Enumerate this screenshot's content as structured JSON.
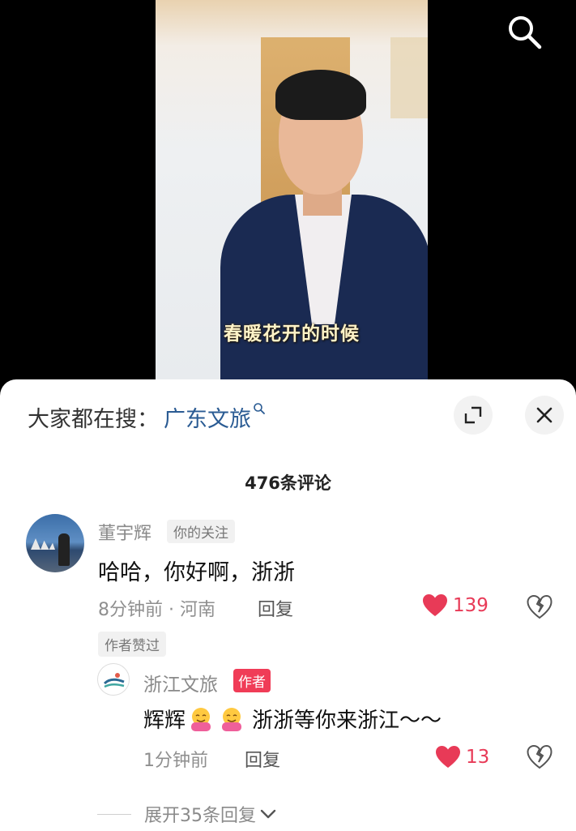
{
  "video": {
    "caption": "春暖花开的时候"
  },
  "top_bar": {
    "search_icon": "search-icon"
  },
  "hot_search": {
    "prefix": "大家都在搜：",
    "term": "广东文旅",
    "term_icon": "search-small-icon"
  },
  "sheet_buttons": {
    "expand_icon": "expand-icon",
    "close_icon": "close-icon"
  },
  "comments": {
    "count_label": "476条评论",
    "items": [
      {
        "username": "董宇辉",
        "badge": "你的关注",
        "text": "哈哈，你好啊，浙浙",
        "time_location": "8分钟前 · 河南",
        "reply_label": "回复",
        "likes": "139",
        "author_liked_tag": "作者赞过",
        "reply": {
          "username": "浙江文旅",
          "badge": "作者",
          "text_before": "辉辉",
          "text_after": "浙浙等你来浙江～～",
          "emoji": [
            "hug-emoji",
            "hug-emoji"
          ],
          "time": "1分钟前",
          "reply_label": "回复",
          "likes": "13"
        },
        "expand_label": "展开35条回复"
      }
    ]
  },
  "colors": {
    "like": "#e83a57",
    "link": "#2a5b93",
    "author_badge": "#f03c57"
  }
}
